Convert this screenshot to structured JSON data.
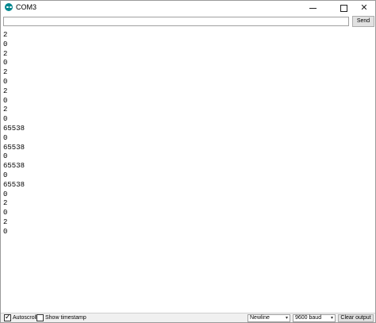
{
  "window": {
    "title": "COM3",
    "minimize_icon": "minimize-icon",
    "maximize_icon": "maximize-icon",
    "close_icon": "close-icon",
    "close_glyph": "✕"
  },
  "input": {
    "value": "",
    "placeholder": ""
  },
  "toolbar": {
    "send_label": "Send"
  },
  "output": {
    "lines": [
      "2",
      "0",
      "2",
      "0",
      "2",
      "0",
      "2",
      "0",
      "2",
      "0",
      "65538",
      "0",
      "65538",
      "0",
      "65538",
      "0",
      "65538",
      "0",
      "2",
      "0",
      "2",
      "0"
    ]
  },
  "bottom": {
    "autoscroll_label": "Autoscroll",
    "autoscroll_checked": true,
    "autoscroll_mark": "✓",
    "timestamp_label": "Show timestamp",
    "timestamp_checked": false,
    "line_ending": "Newline",
    "baud_rate": "9600 baud",
    "dropdown_arrow": "▾",
    "clear_label": "Clear output"
  },
  "colors": {
    "app_icon": "#00878f",
    "button_face": "#e1e1e1",
    "status_bar": "#f0f0f0"
  }
}
